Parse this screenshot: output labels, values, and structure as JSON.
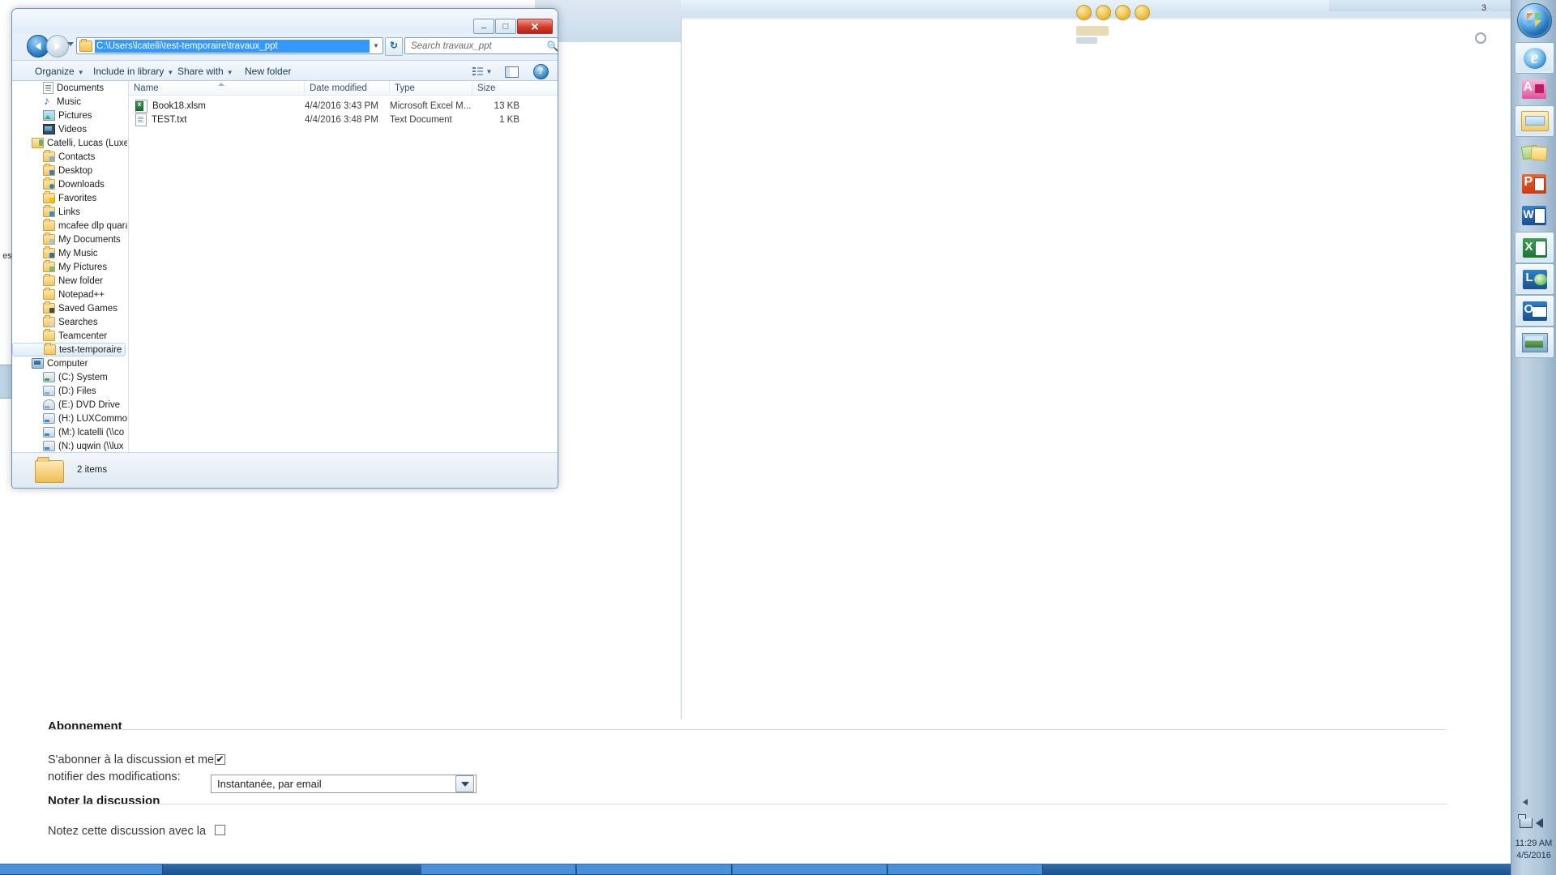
{
  "explorer": {
    "address_path": "C:\\Users\\lcatelli\\test-temporaire\\travaux_ppt",
    "search_placeholder": "Search travaux_ppt",
    "window_buttons": {
      "minimize": "–",
      "maximize": "□",
      "close": "✕"
    },
    "toolbar": {
      "organize": "Organize",
      "include_in_library": "Include in library",
      "share_with": "Share with",
      "new_folder": "New folder",
      "caret": "▼",
      "help": "?"
    },
    "columns": [
      {
        "key": "name",
        "label": "Name"
      },
      {
        "key": "date",
        "label": "Date modified"
      },
      {
        "key": "type",
        "label": "Type"
      },
      {
        "key": "size",
        "label": "Size"
      }
    ],
    "files": [
      {
        "name": "Book18.xlsm",
        "date": "4/4/2016 3:43 PM",
        "type": "Microsoft Excel M...",
        "size": "13 KB",
        "icon": "excel-macro-file-icon"
      },
      {
        "name": "TEST.txt",
        "date": "4/4/2016 3:48 PM",
        "type": "Text Document",
        "size": "1 KB",
        "icon": "text-file-icon"
      }
    ],
    "status": "2 items",
    "nav_tree": [
      {
        "label": "Documents",
        "icon": "documents-icon",
        "indent": 2,
        "selected": false
      },
      {
        "label": "Music",
        "icon": "music-icon",
        "indent": 2,
        "selected": false
      },
      {
        "label": "Pictures",
        "icon": "pictures-icon",
        "indent": 2,
        "selected": false
      },
      {
        "label": "Videos",
        "icon": "videos-icon",
        "indent": 2,
        "selected": false
      },
      {
        "label": "Catelli, Lucas (Luxe",
        "icon": "user-folder-icon",
        "indent": 1,
        "selected": false
      },
      {
        "label": "Contacts",
        "icon": "contacts-folder-icon",
        "indent": 2,
        "selected": false
      },
      {
        "label": "Desktop",
        "icon": "desktop-folder-icon",
        "indent": 2,
        "selected": false
      },
      {
        "label": "Downloads",
        "icon": "downloads-folder-icon",
        "indent": 2,
        "selected": false
      },
      {
        "label": "Favorites",
        "icon": "favorites-folder-icon",
        "indent": 2,
        "selected": false
      },
      {
        "label": "Links",
        "icon": "links-folder-icon",
        "indent": 2,
        "selected": false
      },
      {
        "label": "mcafee dlp quara",
        "icon": "folder-icon",
        "indent": 2,
        "selected": false
      },
      {
        "label": "My Documents",
        "icon": "my-documents-folder-icon",
        "indent": 2,
        "selected": false
      },
      {
        "label": "My Music",
        "icon": "my-music-folder-icon",
        "indent": 2,
        "selected": false
      },
      {
        "label": "My Pictures",
        "icon": "my-pictures-folder-icon",
        "indent": 2,
        "selected": false
      },
      {
        "label": "New folder",
        "icon": "folder-icon",
        "indent": 2,
        "selected": false
      },
      {
        "label": "Notepad++",
        "icon": "folder-icon",
        "indent": 2,
        "selected": false
      },
      {
        "label": "Saved Games",
        "icon": "saved-games-folder-icon",
        "indent": 2,
        "selected": false
      },
      {
        "label": "Searches",
        "icon": "searches-folder-icon",
        "indent": 2,
        "selected": false
      },
      {
        "label": "Teamcenter",
        "icon": "folder-icon",
        "indent": 2,
        "selected": false
      },
      {
        "label": "test-temporaire",
        "icon": "folder-icon",
        "indent": 2,
        "selected": true
      },
      {
        "label": "Computer",
        "icon": "computer-icon",
        "indent": 1,
        "selected": false
      },
      {
        "label": "(C:) System",
        "icon": "system-drive-icon",
        "indent": 2,
        "selected": false
      },
      {
        "label": "(D:) Files",
        "icon": "drive-icon",
        "indent": 2,
        "selected": false
      },
      {
        "label": "(E:) DVD Drive",
        "icon": "dvd-drive-icon",
        "indent": 2,
        "selected": false
      },
      {
        "label": "(H:) LUXCommon",
        "icon": "network-drive-icon",
        "indent": 2,
        "selected": false
      },
      {
        "label": "(M:) lcatelli (\\\\co",
        "icon": "network-drive-icon",
        "indent": 2,
        "selected": false
      },
      {
        "label": "(N:) uqwin (\\\\lux",
        "icon": "network-drive-icon",
        "indent": 2,
        "selected": false
      }
    ]
  },
  "form": {
    "section_subscription": "Abonnement",
    "subscribe_label_line1": "S'abonner à la discussion et me",
    "subscribe_label_line2": "notifier des modifications:",
    "subscribe_checked": true,
    "notify_value": "Instantanée, par email",
    "section_rating": "Noter la discussion",
    "rate_label": "Notez cette discussion avec la",
    "rate_checked": false
  },
  "taskbar": {
    "start": "start-orb",
    "apps": [
      {
        "name": "internet-explorer",
        "icon": "ie-icon",
        "running": true
      },
      {
        "name": "microsoft-access",
        "icon": "access-icon",
        "running": false
      },
      {
        "name": "windows-explorer",
        "icon": "explorer-folder-icon",
        "running": true
      },
      {
        "name": "sticky-notes",
        "icon": "sticky-notes-icon",
        "running": false
      },
      {
        "name": "powerpoint",
        "icon": "powerpoint-icon",
        "running": false
      },
      {
        "name": "word",
        "icon": "word-icon",
        "running": false
      },
      {
        "name": "excel",
        "icon": "excel-icon",
        "running": true
      },
      {
        "name": "lync",
        "icon": "lync-icon",
        "running": true
      },
      {
        "name": "outlook",
        "icon": "outlook-icon",
        "running": true
      },
      {
        "name": "photo-viewer",
        "icon": "photo-viewer-icon",
        "running": true
      }
    ],
    "tray": [
      {
        "name": "network-icon"
      },
      {
        "name": "volume-icon"
      }
    ],
    "clock_time": "11:29 AM",
    "clock_date": "4/5/2016"
  },
  "browser": {
    "page_counter": "3"
  },
  "colors": {
    "accent_blue": "#3399ff",
    "aero_frame": "#6b96bd",
    "close_red": "#d33b2a",
    "taskbar": "#aec5d8"
  }
}
